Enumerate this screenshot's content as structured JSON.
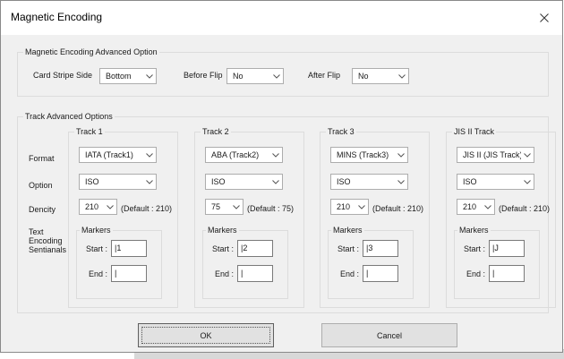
{
  "window": {
    "title": "Magnetic Encoding"
  },
  "advanced_option": {
    "legend": "Magnetic Encoding Advanced Option",
    "card_stripe_side": {
      "label": "Card Stripe Side",
      "value": "Bottom"
    },
    "before_flip": {
      "label": "Before Flip",
      "value": "No"
    },
    "after_flip": {
      "label": "After Flip",
      "value": "No"
    }
  },
  "track_options": {
    "legend": "Track Advanced Options",
    "row_labels": {
      "format": "Format",
      "option": "Option",
      "dencity": "Dencity",
      "sentinels_1": "Text",
      "sentinels_2": "Encoding",
      "sentinels_3": "Sentianals"
    },
    "markers_legend": "Markers",
    "start_label": "Start :",
    "end_label": "End :",
    "tracks": [
      {
        "name": "Track 1",
        "format": "IATA (Track1)",
        "option": "ISO",
        "density": "210",
        "default": "(Default : 210)",
        "start": "|1",
        "end": "|"
      },
      {
        "name": "Track 2",
        "format": "ABA (Track2)",
        "option": "ISO",
        "density": "75",
        "default": "(Default : 75)",
        "start": "|2",
        "end": "|"
      },
      {
        "name": "Track 3",
        "format": "MINS (Track3)",
        "option": "ISO",
        "density": "210",
        "default": "(Default : 210)",
        "start": "|3",
        "end": "|"
      },
      {
        "name": "JIS II Track",
        "format": "JIS II (JIS Track)",
        "option": "ISO",
        "density": "210",
        "default": "(Default : 210)",
        "start": "|J",
        "end": "|"
      }
    ]
  },
  "buttons": {
    "ok": "OK",
    "cancel": "Cancel"
  },
  "icons": {
    "close": "close-icon",
    "dropdown": "chevron-down-icon"
  }
}
